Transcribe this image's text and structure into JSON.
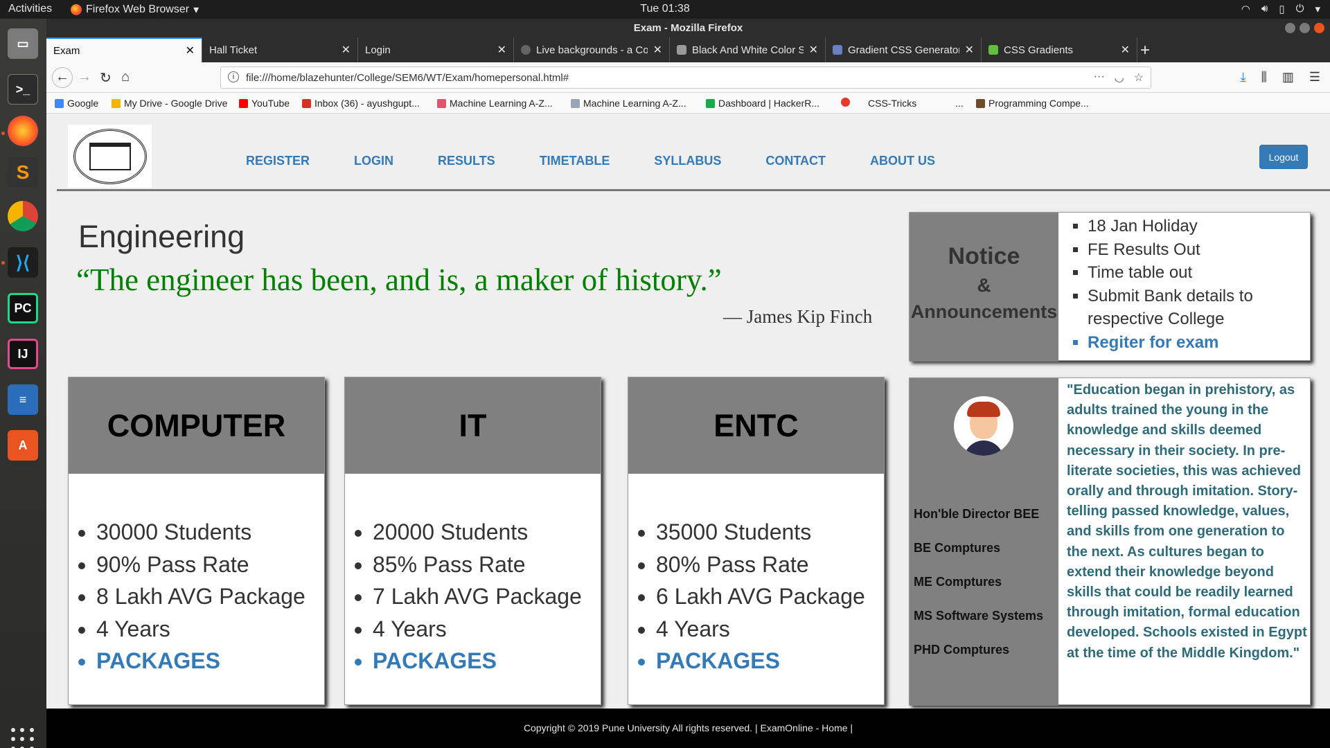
{
  "os_topbar": {
    "activities": "Activities",
    "app_name": "Firefox Web Browser",
    "clock": "Tue 01:38"
  },
  "window": {
    "title": "Exam - Mozilla Firefox"
  },
  "tabs": [
    {
      "label": "Exam",
      "active": true
    },
    {
      "label": "Hall Ticket",
      "active": false
    },
    {
      "label": "Login",
      "active": false
    },
    {
      "label": "Live backgrounds - a Coll",
      "active": false
    },
    {
      "label": "Black And White Color S",
      "active": false
    },
    {
      "label": "Gradient CSS Generator",
      "active": false
    },
    {
      "label": "CSS Gradients",
      "active": false
    }
  ],
  "address_bar": {
    "url": "file:///home/blazehunter/College/SEM6/WT/Exam/homepersonal.html#"
  },
  "bookmarks": [
    {
      "label": "Google",
      "color": "#4285f4"
    },
    {
      "label": "My Drive - Google Drive",
      "color": "#f4b400"
    },
    {
      "label": "YouTube",
      "color": "#ff0000"
    },
    {
      "label": "Inbox (36) - ayushgupt...",
      "color": "#d93025"
    },
    {
      "label": "Machine Learning A-Z...",
      "color": "#e0556a"
    },
    {
      "label": "Machine Learning A-Z...",
      "color": "#9aa6b8"
    },
    {
      "label": "Dashboard | HackerR...",
      "color": "#1ba94c"
    },
    {
      "label": "",
      "color": "#e8382c"
    },
    {
      "label": "CSS-Tricks",
      "color": "#f9f9fa"
    },
    {
      "label": "...",
      "color": "#f9f9fa"
    },
    {
      "label": "Programming Compe...",
      "color": "#6d4c2a"
    }
  ],
  "page": {
    "nav": [
      "REGISTER",
      "LOGIN",
      "RESULTS",
      "TIMETABLE",
      "SYLLABUS",
      "CONTACT",
      "ABOUT US"
    ],
    "logout_label": "Logout",
    "hero": {
      "title": "Engineering",
      "quote": "“The engineer has been, and is, a maker of history.”",
      "author": "— James Kip Finch"
    },
    "cards": [
      {
        "title": "COMPUTER",
        "items": [
          "30000 Students",
          "90% Pass Rate",
          "8 Lakh AVG Package",
          "4 Years"
        ],
        "link": "PACKAGES"
      },
      {
        "title": "IT",
        "items": [
          "20000 Students",
          "85% Pass Rate",
          "7 Lakh AVG Package",
          "4 Years"
        ],
        "link": "PACKAGES"
      },
      {
        "title": "ENTC",
        "items": [
          "35000 Students",
          "80% Pass Rate",
          "6 Lakh AVG Package",
          "4 Years"
        ],
        "link": "PACKAGES"
      }
    ],
    "notice": {
      "heading_1": "Notice",
      "heading_2": "&",
      "heading_3": "Announcements",
      "items": [
        "18 Jan Holiday",
        "FE Results Out",
        "Time table out",
        "Submit Bank details to respective College"
      ],
      "link": "Regiter for exam"
    },
    "director": {
      "roles": [
        "Hon'ble Director BEE",
        "BE Comptures",
        "ME Comptures",
        "MS Software Systems",
        "PHD Comptures"
      ],
      "quote": "\"Education began in prehistory, as adults trained the young in the knowledge and skills deemed necessary in their society. In pre-literate societies, this was achieved orally and through imitation. Story-telling passed knowledge, values, and skills from one generation to the next. As cultures began to extend their knowledge beyond skills that could be readily learned through imitation, formal education developed. Schools existed in Egypt at the time of the Middle Kingdom.\""
    },
    "footer": "Copyright © 2019 Pune University All rights reserved. | ExamOnline - Home |"
  },
  "colors": {
    "accent_link": "#337ab7",
    "quote_green": "#008000",
    "card_header_gray": "#808080",
    "director_quote": "#2e6b7a"
  }
}
